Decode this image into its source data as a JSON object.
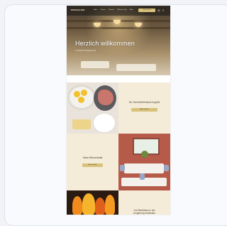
{
  "site": {
    "logo": "PINZGAUER",
    "nav": [
      "Hotel",
      "Zimmer",
      "Kulinarik",
      "Wellness & Spa",
      "Aktiv"
    ],
    "cta": "Jetzt buchen",
    "lang_icon": "globe-icon",
    "menu_icon": "menu-icon"
  },
  "hero": {
    "title": "Herzlich willkommen",
    "subtitle": "im Gasthof Pinzgauer Hof"
  },
  "tiles": [
    {
      "label": "Ein Genießerfrühstück begrüßt",
      "button": "Mehr erfahren"
    },
    {
      "label": "Stube Bierwerkstatt",
      "button": "Mehr erfahren"
    },
    {
      "label": "Gut Steakhaus in der",
      "sub": "Umgebung entdecken"
    }
  ],
  "colors": {
    "accent": "#d8c27a",
    "cream": "#f4ecd9",
    "nav_bg": "#1c1a18"
  }
}
